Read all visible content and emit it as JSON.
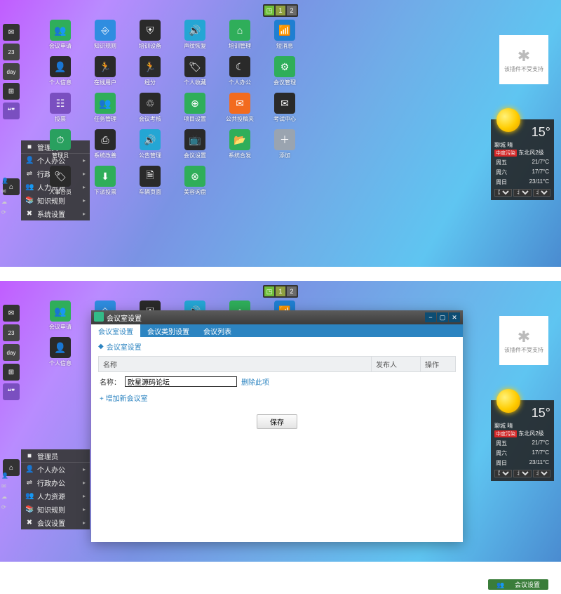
{
  "pager": {
    "icon": "◳",
    "p1": "1",
    "p2": "2"
  },
  "leftdock": {
    "items": [
      {
        "name": "mail-icon",
        "glyph": "✉"
      },
      {
        "name": "calendar-icon",
        "glyph": "23"
      },
      {
        "name": "day-icon",
        "glyph": "day"
      },
      {
        "name": "grid-icon",
        "glyph": "⊞"
      },
      {
        "name": "chat-icon",
        "glyph": "❝❞"
      }
    ],
    "home": "⌂"
  },
  "status_icons": [
    "👤",
    "✉",
    "☁",
    "⟳"
  ],
  "startmenu": {
    "title": "管理员",
    "items": [
      {
        "icon": "👤",
        "label": "个人办公"
      },
      {
        "icon": "⇌",
        "label": "行政办公"
      },
      {
        "icon": "👥",
        "label": "人力资源"
      },
      {
        "icon": "📚",
        "label": "知识规则"
      },
      {
        "icon": "✖",
        "label": "系统设置"
      }
    ]
  },
  "startmenu2": {
    "title": "管理员",
    "items": [
      {
        "icon": "👤",
        "label": "个人办公"
      },
      {
        "icon": "⇌",
        "label": "行政办公"
      },
      {
        "icon": "👥",
        "label": "人力资源"
      },
      {
        "icon": "📚",
        "label": "知识规则"
      },
      {
        "icon": "✖",
        "label": "会议设置"
      }
    ]
  },
  "grid": [
    {
      "label": "会议申请",
      "bg": "#2fae5a",
      "glyph": "👥"
    },
    {
      "label": "知识规则",
      "bg": "#2f8de0",
      "glyph": "⎆"
    },
    {
      "label": "培训设备",
      "bg": "#2a2a2a",
      "glyph": "⛨"
    },
    {
      "label": "声纹恢复",
      "bg": "#24a6d4",
      "glyph": "🔊"
    },
    {
      "label": "培训管理",
      "bg": "#2fae5a",
      "glyph": "⌂"
    },
    {
      "label": "短消息",
      "bg": "#1f7fd1",
      "glyph": "📶"
    },
    {
      "label": "",
      "bg": "",
      "glyph": ""
    },
    {
      "label": "个人信息",
      "bg": "#2a2a2a",
      "glyph": "👤"
    },
    {
      "label": "在线用户",
      "bg": "#2a2a2a",
      "glyph": "🏃"
    },
    {
      "label": "经分",
      "bg": "#2a2a2a",
      "glyph": "🏃"
    },
    {
      "label": "个人收藏",
      "bg": "#2a2a2a",
      "glyph": "🏷"
    },
    {
      "label": "个人办公",
      "bg": "#2a2a2a",
      "glyph": "☾"
    },
    {
      "label": "会议管理",
      "bg": "#2fae5a",
      "glyph": "⚙"
    },
    {
      "label": "",
      "bg": "",
      "glyph": ""
    },
    {
      "label": "投票",
      "bg": "#7a4fc0",
      "glyph": "☷"
    },
    {
      "label": "任务管理",
      "bg": "#2fae5a",
      "glyph": "👥"
    },
    {
      "label": "会议考核",
      "bg": "#2a2a2a",
      "glyph": "♲"
    },
    {
      "label": "项目设置",
      "bg": "#2fae5a",
      "glyph": "⊕"
    },
    {
      "label": "公共投稿夹",
      "bg": "#f26b1f",
      "glyph": "✉"
    },
    {
      "label": "考试中心",
      "bg": "#2a2a2a",
      "glyph": "✉"
    },
    {
      "label": "",
      "bg": "",
      "glyph": ""
    },
    {
      "label": "管理员",
      "bg": "#29a05f",
      "glyph": "⏱"
    },
    {
      "label": "系统改善",
      "bg": "#2a2a2a",
      "glyph": "⎙"
    },
    {
      "label": "公告管理",
      "bg": "#24a6d4",
      "glyph": "🔊"
    },
    {
      "label": "会议设置",
      "bg": "#2a2a2a",
      "glyph": "📺"
    },
    {
      "label": "系统合发",
      "bg": "#2fae5a",
      "glyph": "📂"
    },
    {
      "label": "添加",
      "bg": "#9aa4b0",
      "glyph": "＋"
    },
    {
      "label": "",
      "bg": "",
      "glyph": ""
    },
    {
      "label": "人事合员",
      "bg": "#2a2a2a",
      "glyph": "🏷"
    },
    {
      "label": "下派投票",
      "bg": "#2fae5a",
      "glyph": "⬇"
    },
    {
      "label": "车辆页面",
      "bg": "#2a2a2a",
      "glyph": "🗎"
    },
    {
      "label": "美容询盘",
      "bg": "#2fae5a",
      "glyph": "⊗"
    },
    {
      "label": "",
      "bg": "",
      "glyph": ""
    },
    {
      "label": "",
      "bg": "",
      "glyph": ""
    },
    {
      "label": "",
      "bg": "",
      "glyph": ""
    }
  ],
  "widget": {
    "glyph": "✱",
    "text": "该插件不受支持"
  },
  "weather": {
    "city": "聊城",
    "cond": "晴",
    "temp": "15°",
    "badge": "中度污染",
    "wind": "东北风2级",
    "days": [
      {
        "d": "周五",
        "t": "21/7°C"
      },
      {
        "d": "周六",
        "t": "17/7°C"
      },
      {
        "d": "周日",
        "t": "23/11°C"
      }
    ],
    "sel1": "国家▾",
    "sel2": "北京▾",
    "sel3": "北京▾"
  },
  "taskbar": {
    "btn": "会议设置"
  },
  "modal": {
    "title": "会议室设置",
    "tabs": [
      "会议室设置",
      "会议类别设置",
      "会议列表"
    ],
    "crumb": "会议室设置",
    "th": [
      "名称",
      "发布人",
      "操作"
    ],
    "field_label": "名称：",
    "field_value": "欧星源码论坛",
    "field_del": "删除此项",
    "addnew": "+ 增加新会议室",
    "save": "保存"
  }
}
